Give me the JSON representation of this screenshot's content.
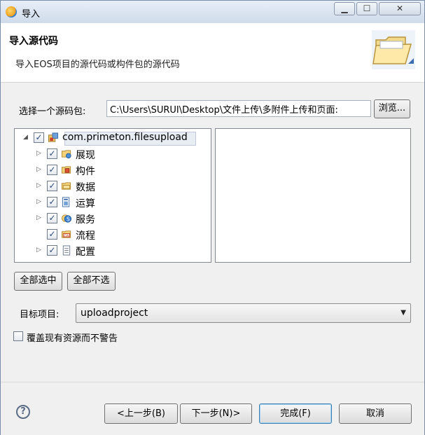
{
  "window": {
    "title": "导入",
    "min_label": "▁",
    "max_label": "☐",
    "close_label": "✕"
  },
  "header": {
    "title": "导入源代码",
    "description": "导入EOS项目的源代码或构件包的源代码",
    "icon": "folder-icon"
  },
  "source": {
    "label": "选择一个源码包:",
    "path_value": "C:\\Users\\SURUI\\Desktop\\文件上传\\多附件上传和页面:",
    "browse_label": "浏览..."
  },
  "tree": {
    "root": {
      "label": "com.primeton.filesupload",
      "checked": true,
      "expanded": true,
      "icon": "package-icon"
    },
    "items": [
      {
        "label": "展现",
        "checked": true,
        "has_children": true,
        "icon": "presentation-folder-icon"
      },
      {
        "label": "构件",
        "checked": true,
        "has_children": true,
        "icon": "component-folder-icon"
      },
      {
        "label": "数据",
        "checked": true,
        "has_children": true,
        "icon": "data-folder-icon"
      },
      {
        "label": "运算",
        "checked": true,
        "has_children": true,
        "icon": "operation-icon"
      },
      {
        "label": "服务",
        "checked": true,
        "has_children": true,
        "icon": "service-icon"
      },
      {
        "label": "流程",
        "checked": true,
        "has_children": false,
        "icon": "process-icon"
      },
      {
        "label": "配置",
        "checked": true,
        "has_children": true,
        "icon": "config-file-icon"
      }
    ]
  },
  "buttons": {
    "select_all": "全部选中",
    "deselect_all": "全部不选",
    "back": "<上一步(B)",
    "next": "下一步(N)>",
    "finish": "完成(F)",
    "cancel": "取消"
  },
  "target": {
    "label": "目标项目:",
    "value": "uploadproject"
  },
  "overwrite": {
    "label": "覆盖现有资源而不警告",
    "checked": false
  },
  "help": {
    "symbol": "?"
  },
  "colors": {
    "accent": "#3c7fb1",
    "title_gradient_top": "#e7eef7",
    "check_color": "#2b4a7a"
  }
}
